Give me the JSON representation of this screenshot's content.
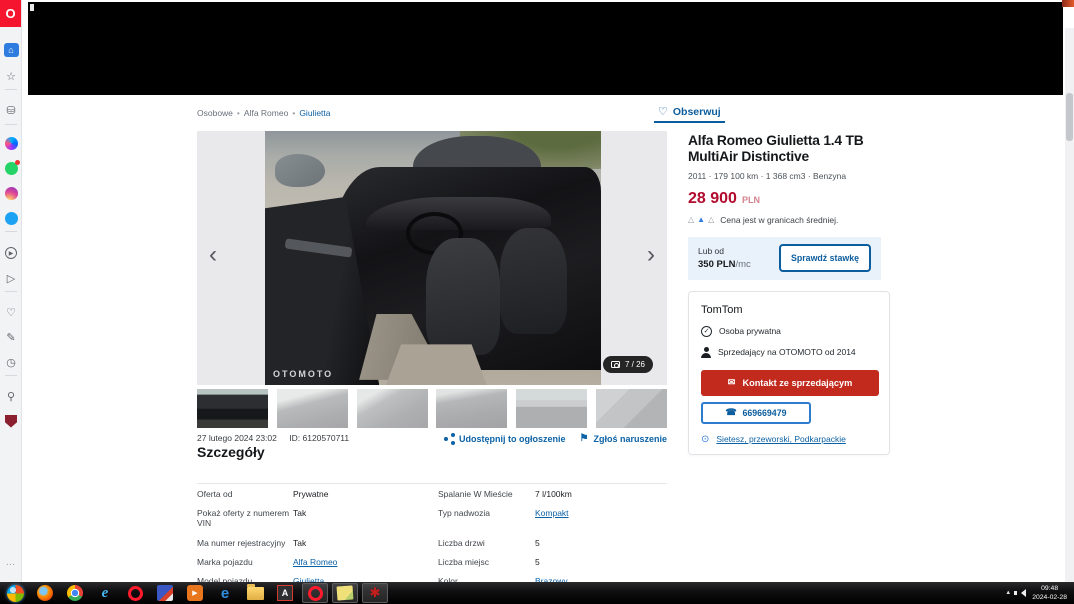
{
  "browser": {
    "sidebar_icons": [
      "opera-logo",
      "workspaces",
      "star",
      "shopping-bag",
      "messenger",
      "whatsapp",
      "instagram",
      "twitter",
      "player",
      "send",
      "heart",
      "compose",
      "history",
      "lightbulb",
      "vpn-shield",
      "more"
    ],
    "logo_letter": "O"
  },
  "breadcrumb": {
    "sep": "•",
    "items": [
      "Osobowe",
      "Alfa Romeo",
      "Giulietta"
    ]
  },
  "observe_label": "Obserwuj",
  "gallery": {
    "counter": "7 / 26",
    "watermark": "OTOMOTO",
    "prev": "‹",
    "next": "›"
  },
  "meta": {
    "date": "27 lutego 2024 23:02",
    "id": "ID: 6120570711",
    "share": "Udostępnij to ogłoszenie",
    "report": "Zgłoś naruszenie"
  },
  "details": {
    "heading": "Szczegóły",
    "rows": [
      {
        "l": "Oferta od",
        "lv": "Prywatne",
        "r": "Spalanie W Mieście",
        "rv": "7 l/100km"
      },
      {
        "l": "Pokaż oferty z numerem VIN",
        "lv": "Tak",
        "r": "Typ nadwozia",
        "rv": "Kompakt"
      },
      {
        "l": "Ma numer rejestracyjny",
        "lv": "Tak",
        "r": "Liczba drzwi",
        "rv": "5"
      },
      {
        "l": "Marka pojazdu",
        "lv": "Alfa Romeo",
        "r": "Liczba miejsc",
        "rv": "5"
      },
      {
        "l": "Model pojazdu",
        "lv": "Giulietta",
        "r": "Kolor",
        "rv": "Brązowy"
      }
    ]
  },
  "listing": {
    "title": "Alfa Romeo Giulietta 1.4 TB MultiAir Distinctive",
    "subtitle": "2011 · 179 100 km · 1 368 cm3 · Benzyna",
    "price": "28 900",
    "currency": "PLN",
    "price_eval": "Cena jest w granicach średniej.",
    "finance": {
      "prefix": "Lub od",
      "amount": "350 PLN",
      "per": "/mc",
      "cta": "Sprawdź stawkę"
    }
  },
  "seller": {
    "name": "TomTom",
    "type": "Osoba prywatna",
    "since": "Sprzedający na OTOMOTO od 2014",
    "contact": "Kontakt ze sprzedającym",
    "phone": "669669479",
    "location": "Sietesz, przeworski, Podkarpackie"
  },
  "taskbar": {
    "time": "09:48",
    "date": "2024-02-28",
    "icons": [
      "start",
      "firefox",
      "chrome",
      "internet-explorer",
      "opera",
      "media-center",
      "media-player",
      "edge",
      "file-explorer",
      "acrobat",
      "opera-active",
      "sticky-notes",
      "photo-app"
    ]
  },
  "colors": {
    "accent_blue": "#0c5d9d",
    "link_blue": "#0c62a6",
    "price_red": "#b20b2e",
    "cta_red": "#c22a1d",
    "opera_red": "#f5152e"
  }
}
